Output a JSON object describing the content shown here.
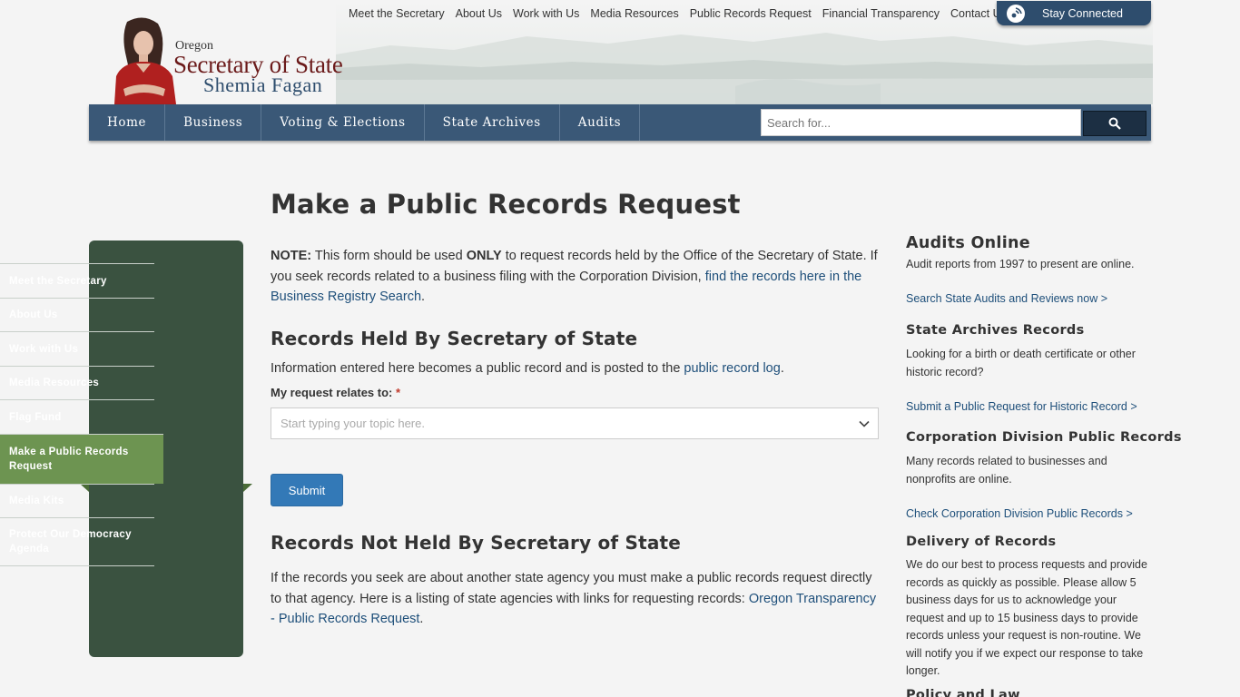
{
  "header": {
    "top_links": [
      "Meet the Secretary",
      "About Us",
      "Work with Us",
      "Media Resources",
      "Public Records Request",
      "Financial Transparency",
      "Contact Us"
    ],
    "stay_connected": "Stay Connected",
    "logo": {
      "state": "Oregon",
      "office": "Secretary of State",
      "name": "Shemia Fagan"
    }
  },
  "nav": {
    "items": [
      "Home",
      "Business",
      "Voting & Elections",
      "State Archives",
      "Audits"
    ],
    "search_placeholder": "Search for..."
  },
  "sidebar": {
    "items": [
      {
        "label": "Meet the Secretary"
      },
      {
        "label": "About Us"
      },
      {
        "label": "Work with Us"
      },
      {
        "label": "Media Resources"
      },
      {
        "label": "Flag Fund"
      },
      {
        "label": "Make a Public Records Request",
        "active": true
      },
      {
        "label": "Media Kits"
      },
      {
        "label": "Protect Our Democracy Agenda"
      }
    ]
  },
  "main": {
    "title": "Make a Public Records Request",
    "note": {
      "label": "NOTE:",
      "text_1": " This form should be used ",
      "only": "ONLY",
      "text_2": " to request records held by the Office of the Secretary of State. If you seek records related to a business filing with the Corporation Division, ",
      "link": "find the records here in the Business Registry Search",
      "end": "."
    },
    "held": {
      "heading": "Records Held By Secretary of State",
      "text": "Information entered here becomes a public record and is posted to the ",
      "link": "public record log",
      "end": ".",
      "field_label": "My request relates to:",
      "required_mark": "*",
      "select_placeholder": "Start typing your topic here.",
      "submit": "Submit"
    },
    "not_held": {
      "heading": "Records Not Held By Secretary of State",
      "text": "If the records you seek are about another state agency you must make a public records request directly to that agency. Here is a listing of state agencies with links for requesting records: ",
      "link": "Oregon Transparency - Public Records Request",
      "end": "."
    }
  },
  "right": {
    "audits": {
      "heading": "Audits Online",
      "text": "Audit reports from 1997 to present are online.",
      "link": "Search State Audits and Reviews now >"
    },
    "archives": {
      "heading": "State Archives Records",
      "text": "Looking for a birth or death certificate or other historic record?",
      "link": "Submit a Public Request for Historic Record >"
    },
    "corp": {
      "heading": "Corporation Division Public Records",
      "text": "Many records related to businesses and nonprofits are online.",
      "link": "Check Corporation Division Public Records >"
    },
    "delivery": {
      "heading": "Delivery of Records",
      "text": "We do our best to process requests and provide records as quickly as possible. Please allow 5 business days for us to acknowledge your request and up to 15 business days to provide records unless your request is non-routine. We will notify you if we expect our response to take longer."
    },
    "policy": {
      "heading": "Policy and Law"
    }
  },
  "colors": {
    "nav_bg": "#3a5877",
    "sidebar_bg": "#3a5240",
    "sidebar_active": "#6d9451",
    "link": "#1e4f7a",
    "submit": "#3379b7"
  }
}
